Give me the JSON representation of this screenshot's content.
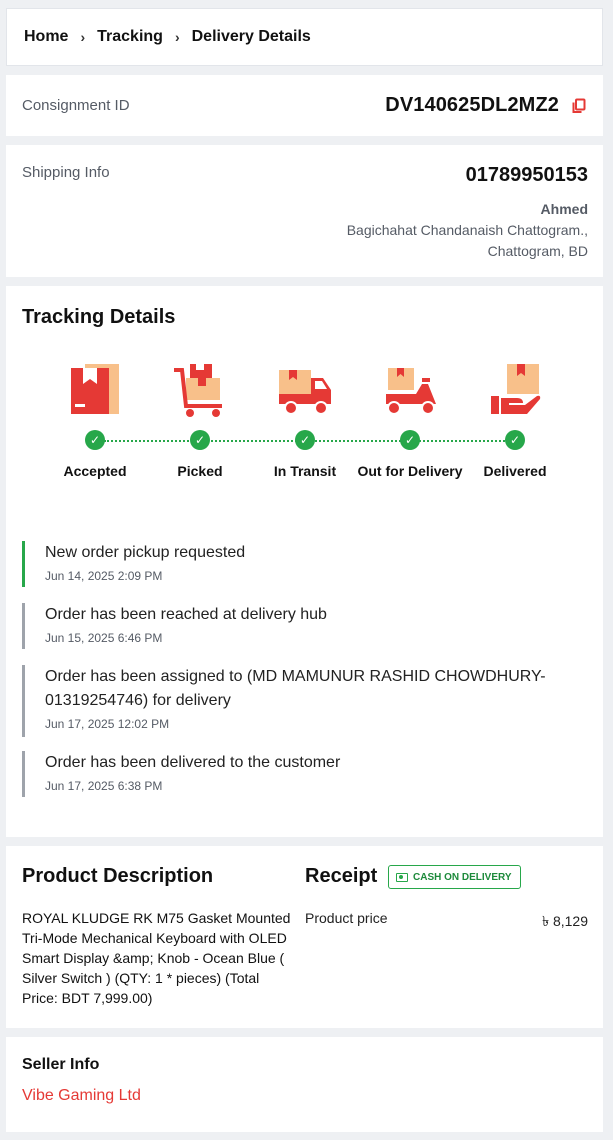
{
  "breadcrumb": [
    "Home",
    "Tracking",
    "Delivery Details"
  ],
  "consignment": {
    "label": "Consignment ID",
    "value": "DV140625DL2MZ2"
  },
  "shipping": {
    "label": "Shipping Info",
    "phone": "01789950153",
    "name": "Ahmed",
    "address_line1": "Bagichahat Chandanaish Chattogram.,",
    "address_line2": "Chattogram, BD"
  },
  "tracking": {
    "title": "Tracking Details",
    "steps": [
      {
        "label": "Accepted",
        "icon": "box-icon",
        "done": true
      },
      {
        "label": "Picked",
        "icon": "cart-icon",
        "done": true
      },
      {
        "label": "In Transit",
        "icon": "truck-icon",
        "done": true
      },
      {
        "label": "Out for Delivery",
        "icon": "scooter-icon",
        "done": true
      },
      {
        "label": "Delivered",
        "icon": "hand-box-icon",
        "done": true
      }
    ],
    "events": [
      {
        "text": "New order pickup requested",
        "date": "Jun 14, 2025 2:09 PM"
      },
      {
        "text": "Order has been reached at delivery hub",
        "date": "Jun 15, 2025 6:46 PM"
      },
      {
        "text": "Order has been assigned to (MD MAMUNUR RASHID CHOWDHURY-01319254746) for delivery",
        "date": "Jun 17, 2025 12:02 PM"
      },
      {
        "text": "Order has been delivered to the customer",
        "date": "Jun 17, 2025 6:38 PM"
      }
    ]
  },
  "product": {
    "title": "Product Description",
    "description": "ROYAL KLUDGE RK M75 Gasket Mounted Tri-Mode Mechanical Keyboard with OLED Smart Display &amp; Knob - Ocean Blue ( Silver Switch ) (QTY: 1 * pieces) (Total Price: BDT 7,999.00)"
  },
  "receipt": {
    "title": "Receipt",
    "badge": "CASH ON DELIVERY",
    "price_label": "Product price",
    "price_value": "৳ 8,129"
  },
  "seller": {
    "title": "Seller Info",
    "name": "Vibe Gaming Ltd"
  },
  "colors": {
    "accent_red": "#e53935",
    "success_green": "#27a74a",
    "icon_peach": "#f8c08a"
  }
}
